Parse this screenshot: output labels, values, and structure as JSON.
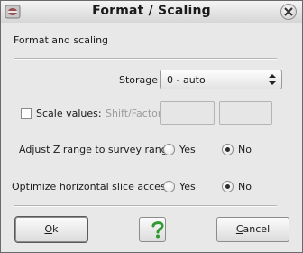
{
  "window": {
    "title": "Format / Scaling",
    "app_icon": "app-icon",
    "close_icon": "close-icon"
  },
  "section": {
    "heading": "Format and scaling"
  },
  "storage": {
    "label": "Storage",
    "selected": "0 - auto",
    "arrow_icon": "updown-arrows-icon"
  },
  "scale": {
    "checkbox_label": "Scale values:",
    "checked": false,
    "shift_factor_label": "Shift/Factor",
    "shift_value": "",
    "factor_value": ""
  },
  "adjust_z": {
    "label": "Adjust Z range to survey range",
    "yes_label": "Yes",
    "no_label": "No",
    "selected": "No"
  },
  "optimize": {
    "label": "Optimize horizontal slice access",
    "yes_label": "Yes",
    "no_label": "No",
    "selected": "No"
  },
  "buttons": {
    "ok_mnemonic": "O",
    "ok_rest": "k",
    "help_icon": "question-mark-icon",
    "cancel_mnemonic": "C",
    "cancel_rest": "ancel"
  },
  "colors": {
    "help_green": "#2f9a2f"
  }
}
